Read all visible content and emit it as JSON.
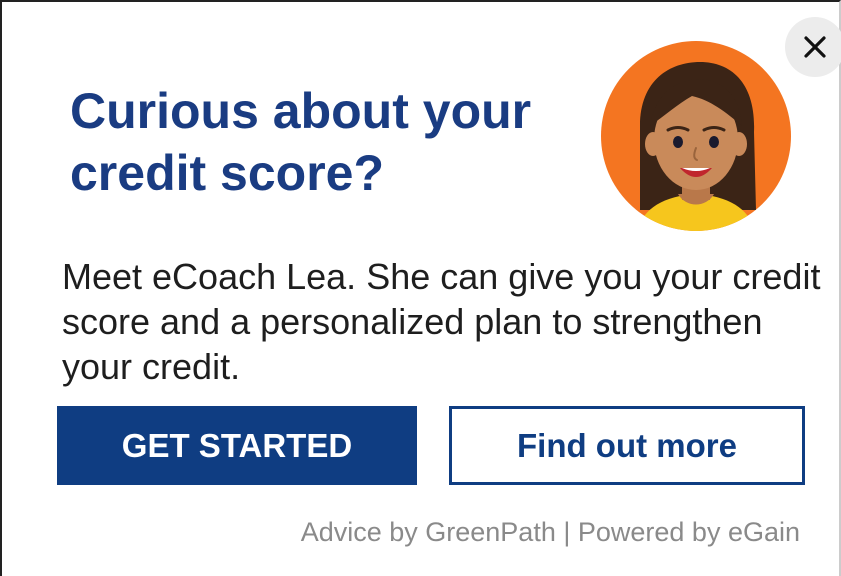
{
  "popup": {
    "title": "Curious about your credit score?",
    "body": "Meet eCoach Lea. She can give you your credit score and a personalized plan to strengthen your credit.",
    "primary_button_label": "GET STARTED",
    "secondary_button_label": "Find out more",
    "footer": "Advice by GreenPath | Powered by eGain",
    "close_icon": "close-icon",
    "avatar_icon": "ecoach-avatar"
  },
  "colors": {
    "title": "#1a3c82",
    "primary_button": "#0f3d82",
    "avatar_background": "#f47521",
    "footer_text": "#8a8a8a"
  }
}
